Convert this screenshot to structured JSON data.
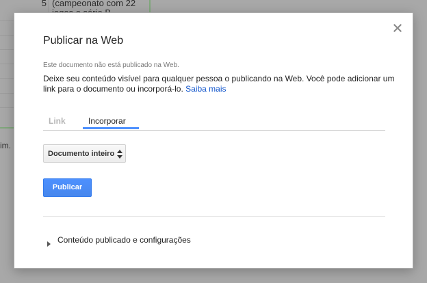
{
  "background": {
    "row_number": "5",
    "cell_text_line1": "(campeonato com 22",
    "cell_text_line2": "jogos e série B",
    "side_text": "im."
  },
  "dialog": {
    "title": "Publicar na Web",
    "status": "Este documento não está publicado na Web.",
    "description": "Deixe seu conteúdo visível para qualquer pessoa o publicando na Web. Você pode adicionar um link para o documento ou incorporá-lo.",
    "learn_more": "Saiba mais",
    "tabs": [
      {
        "label": "Link",
        "active": false
      },
      {
        "label": "Incorporar",
        "active": true
      }
    ],
    "select": {
      "value": "Documento inteiro",
      "icon": "up-down-arrows-icon"
    },
    "publish_button": "Publicar",
    "expander": {
      "label": "Conteúdo publicado e configurações",
      "icon": "triangle-right-icon",
      "expanded": false
    },
    "close_icon": "close-icon"
  },
  "colors": {
    "accent": "#4d90fe",
    "link": "#1155cc",
    "overlay": "#a8a8a8"
  }
}
